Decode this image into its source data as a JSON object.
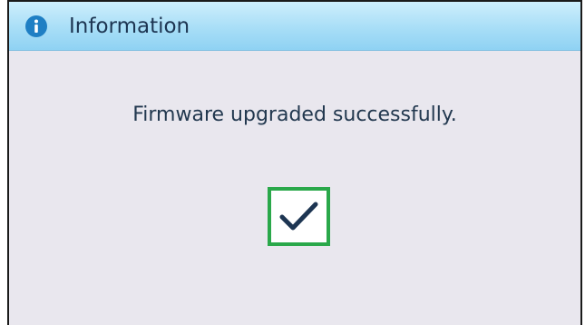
{
  "dialog": {
    "title": "Information",
    "message": "Firmware upgraded successfully.",
    "header_icon": "info-icon",
    "confirm_icon": "checkmark-icon"
  },
  "colors": {
    "header_gradient_top": "#cdeefc",
    "header_gradient_bottom": "#8fd2f3",
    "icon_blue": "#1f7fc4",
    "text": "#22384f",
    "background": "#e9e7ee",
    "confirm_border": "#2aa84a",
    "checkmark": "#1d3552"
  }
}
